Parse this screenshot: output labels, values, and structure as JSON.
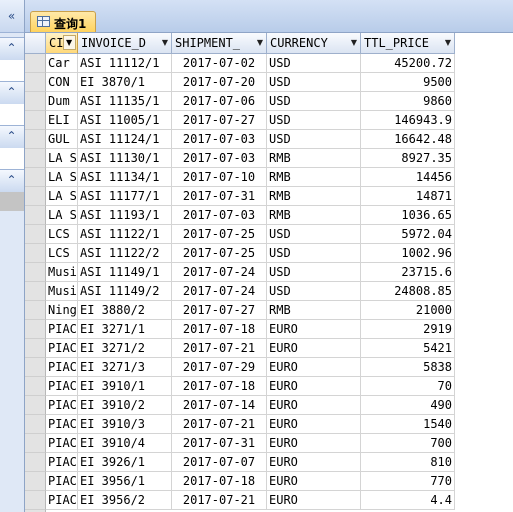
{
  "nav": {
    "collapse_icon": "double-chevron-left",
    "group_icon": "double-chevron-up"
  },
  "tab": {
    "label": "查询1",
    "icon": "query-datasheet-icon"
  },
  "columns": [
    {
      "label": "CI"
    },
    {
      "label": "INVOICE_D"
    },
    {
      "label": "SHIPMENT_"
    },
    {
      "label": "CURRENCY"
    },
    {
      "label": "TTL_PRICE"
    }
  ],
  "rows": [
    {
      "c0": "Car",
      "c1": "ASI 11112/1",
      "c2": "2017-07-02",
      "c3": "USD",
      "c4": "45200.72"
    },
    {
      "c0": "CON",
      "c1": "EI 3870/1",
      "c2": "2017-07-20",
      "c3": "USD",
      "c4": "9500"
    },
    {
      "c0": "Dum",
      "c1": "ASI 11135/1",
      "c2": "2017-07-06",
      "c3": "USD",
      "c4": "9860"
    },
    {
      "c0": "ELI",
      "c1": "ASI 11005/1",
      "c2": "2017-07-27",
      "c3": "USD",
      "c4": "146943.9"
    },
    {
      "c0": "GUL",
      "c1": "ASI 11124/1",
      "c2": "2017-07-03",
      "c3": "USD",
      "c4": "16642.48"
    },
    {
      "c0": "LA S",
      "c1": "ASI 11130/1",
      "c2": "2017-07-03",
      "c3": "RMB",
      "c4": "8927.35"
    },
    {
      "c0": "LA S",
      "c1": "ASI 11134/1",
      "c2": "2017-07-10",
      "c3": "RMB",
      "c4": "14456"
    },
    {
      "c0": "LA S",
      "c1": "ASI 11177/1",
      "c2": "2017-07-31",
      "c3": "RMB",
      "c4": "14871"
    },
    {
      "c0": "LA S",
      "c1": "ASI 11193/1",
      "c2": "2017-07-03",
      "c3": "RMB",
      "c4": "1036.65"
    },
    {
      "c0": "LCS",
      "c1": "ASI 11122/1",
      "c2": "2017-07-25",
      "c3": "USD",
      "c4": "5972.04"
    },
    {
      "c0": "LCS",
      "c1": "ASI 11122/2",
      "c2": "2017-07-25",
      "c3": "USD",
      "c4": "1002.96"
    },
    {
      "c0": "Musi",
      "c1": "ASI 11149/1",
      "c2": "2017-07-24",
      "c3": "USD",
      "c4": "23715.6"
    },
    {
      "c0": "Musi",
      "c1": "ASI 11149/2",
      "c2": "2017-07-24",
      "c3": "USD",
      "c4": "24808.85"
    },
    {
      "c0": "Ning",
      "c1": "EI 3880/2",
      "c2": "2017-07-27",
      "c3": "RMB",
      "c4": "21000"
    },
    {
      "c0": "PIAC",
      "c1": "EI 3271/1",
      "c2": "2017-07-18",
      "c3": "EURO",
      "c4": "2919"
    },
    {
      "c0": "PIAC",
      "c1": "EI 3271/2",
      "c2": "2017-07-21",
      "c3": "EURO",
      "c4": "5421"
    },
    {
      "c0": "PIAC",
      "c1": "EI 3271/3",
      "c2": "2017-07-29",
      "c3": "EURO",
      "c4": "5838"
    },
    {
      "c0": "PIAC",
      "c1": "EI 3910/1",
      "c2": "2017-07-18",
      "c3": "EURO",
      "c4": "70"
    },
    {
      "c0": "PIAC",
      "c1": "EI 3910/2",
      "c2": "2017-07-14",
      "c3": "EURO",
      "c4": "490"
    },
    {
      "c0": "PIAC",
      "c1": "EI 3910/3",
      "c2": "2017-07-21",
      "c3": "EURO",
      "c4": "1540"
    },
    {
      "c0": "PIAC",
      "c1": "EI 3910/4",
      "c2": "2017-07-31",
      "c3": "EURO",
      "c4": "700"
    },
    {
      "c0": "PIAC",
      "c1": "EI 3926/1",
      "c2": "2017-07-07",
      "c3": "EURO",
      "c4": "810"
    },
    {
      "c0": "PIAC",
      "c1": "EI 3956/1",
      "c2": "2017-07-18",
      "c3": "EURO",
      "c4": "770"
    },
    {
      "c0": "PIAC",
      "c1": "EI 3956/2",
      "c2": "2017-07-21",
      "c3": "EURO",
      "c4": "4.4"
    }
  ]
}
